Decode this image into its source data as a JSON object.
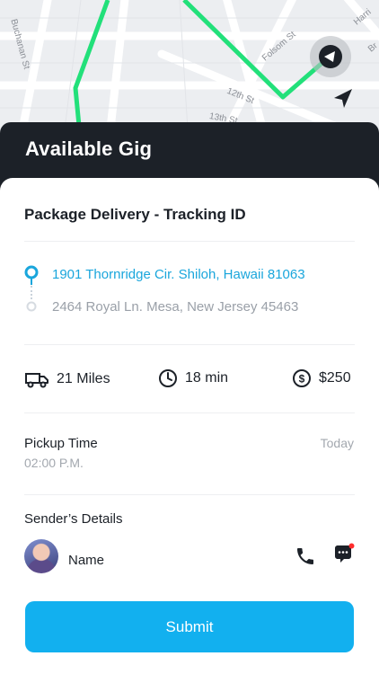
{
  "map": {
    "streets": [
      "Buchanan St",
      "Folsom St",
      "Harri",
      "12th St",
      "13th St",
      "Br"
    ]
  },
  "header": {
    "title": "Available Gig"
  },
  "gig": {
    "title": "Package Delivery - Tracking ID",
    "pickup_address": "1901 Thornridge Cir. Shiloh, Hawaii 81063",
    "dropoff_address": "2464 Royal Ln. Mesa, New Jersey 45463",
    "distance": "21 Miles",
    "duration": "18 min",
    "price": "$250",
    "pickup_time_label": "Pickup Time",
    "pickup_time_value": "02:00 P.M.",
    "pickup_day": "Today",
    "sender_label": "Sender’s Details",
    "sender_name": "Name"
  },
  "actions": {
    "submit_label": "Submit"
  },
  "colors": {
    "accent": "#12b0ef",
    "route": "#22e07a",
    "header": "#1c2128",
    "notification_dot": "#ff2d2d"
  },
  "icons": [
    "navigation-marker-icon",
    "navigation-arrow-icon",
    "location-pin-icon",
    "truck-icon",
    "clock-icon",
    "dollar-icon",
    "phone-icon",
    "chat-icon"
  ]
}
